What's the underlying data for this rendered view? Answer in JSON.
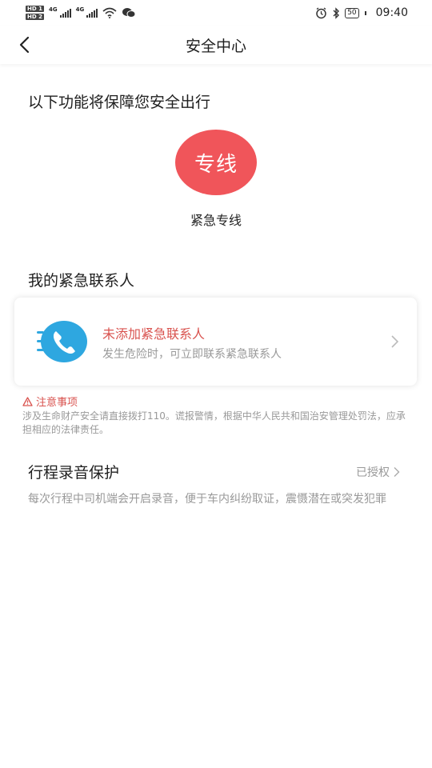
{
  "status_bar": {
    "sim1": "HD 1",
    "sim2": "HD 2",
    "network1": "4G",
    "network2": "4G",
    "battery": "50",
    "time": "09:40"
  },
  "nav": {
    "title": "安全中心"
  },
  "safety_section": {
    "heading": "以下功能将保障您安全出行",
    "hotline_button": "专线",
    "hotline_label": "紧急专线",
    "hotline_color": "#f0555a"
  },
  "contacts_section": {
    "heading": "我的紧急联系人",
    "card_title": "未添加紧急联系人",
    "card_subtitle": "发生危险时，可立即联系紧急联系人",
    "icon_color": "#2ea7e0"
  },
  "notice": {
    "title": "注意事项",
    "text": "涉及生命财产安全请直接拨打110。谎报警情，根据中华人民共和国治安管理处罚法，应承担相应的法律责任。"
  },
  "recording": {
    "heading": "行程录音保护",
    "status": "已授权",
    "description": "每次行程中司机端会开启录音，便于车内纠纷取证，震慑潜在或突发犯罪"
  }
}
